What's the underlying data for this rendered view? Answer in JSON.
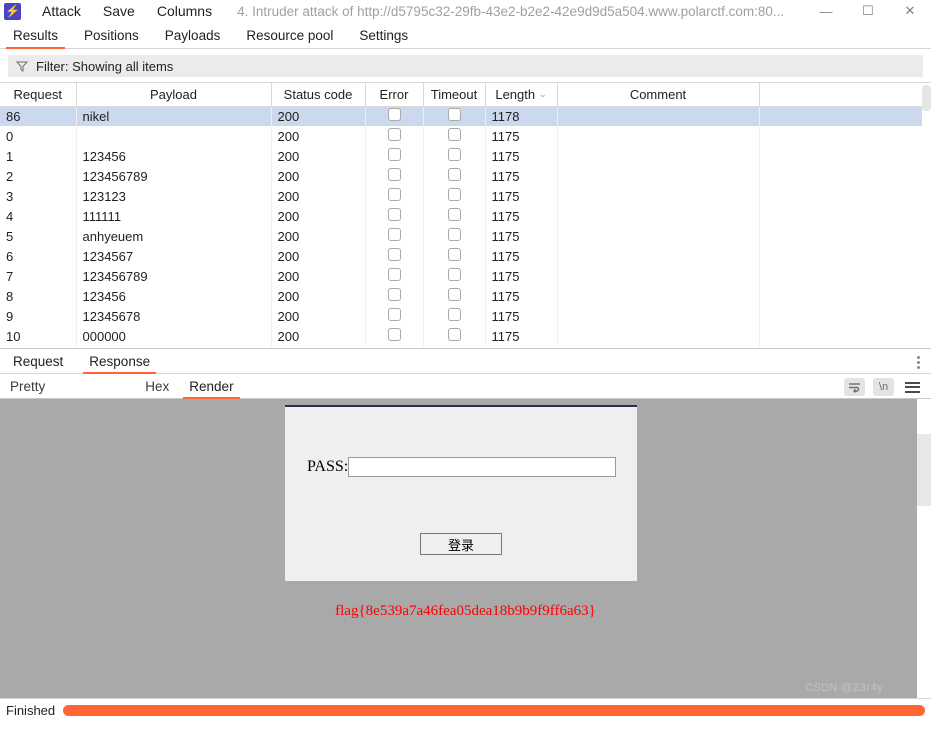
{
  "window": {
    "app_icon": "burp-lightning-icon",
    "title": "4. Intruder attack of http://d5795c32-29fb-43e2-b2e2-42e9d9d5a504.www.polarctf.com:80...",
    "menu": [
      "Attack",
      "Save",
      "Columns"
    ],
    "controls": {
      "minimize": "—",
      "maximize": "☐",
      "close": "✕"
    }
  },
  "tabs": [
    {
      "label": "Results",
      "active": true
    },
    {
      "label": "Positions",
      "active": false
    },
    {
      "label": "Payloads",
      "active": false
    },
    {
      "label": "Resource pool",
      "active": false
    },
    {
      "label": "Settings",
      "active": false
    }
  ],
  "filter": {
    "icon": "funnel-icon",
    "text": "Filter: Showing all items"
  },
  "results_table": {
    "columns": [
      "Request",
      "Payload",
      "Status code",
      "Error",
      "Timeout",
      "Length",
      "Comment",
      ""
    ],
    "sorted_column": "Length",
    "sort_indicator": "⌄",
    "rows": [
      {
        "request": "86",
        "payload": "nikel",
        "status": "200",
        "length": "1178",
        "selected": true
      },
      {
        "request": "0",
        "payload": "",
        "status": "200",
        "length": "1175",
        "selected": false
      },
      {
        "request": "1",
        "payload": "123456",
        "status": "200",
        "length": "1175",
        "selected": false
      },
      {
        "request": "2",
        "payload": "123456789",
        "status": "200",
        "length": "1175",
        "selected": false
      },
      {
        "request": "3",
        "payload": "123123",
        "status": "200",
        "length": "1175",
        "selected": false
      },
      {
        "request": "4",
        "payload": "111111",
        "status": "200",
        "length": "1175",
        "selected": false
      },
      {
        "request": "5",
        "payload": "anhyeuem",
        "status": "200",
        "length": "1175",
        "selected": false
      },
      {
        "request": "6",
        "payload": "1234567",
        "status": "200",
        "length": "1175",
        "selected": false
      },
      {
        "request": "7",
        "payload": "123456789",
        "status": "200",
        "length": "1175",
        "selected": false
      },
      {
        "request": "8",
        "payload": "123456",
        "status": "200",
        "length": "1175",
        "selected": false
      },
      {
        "request": "9",
        "payload": "12345678",
        "status": "200",
        "length": "1175",
        "selected": false
      },
      {
        "request": "10",
        "payload": "000000",
        "status": "200",
        "length": "1175",
        "selected": false
      }
    ]
  },
  "message_tabs": [
    {
      "label": "Request",
      "active": false
    },
    {
      "label": "Response",
      "active": true
    }
  ],
  "view_tabs": [
    {
      "label": "Pretty",
      "active": false
    },
    {
      "label": "Hex",
      "active": false
    },
    {
      "label": "Render",
      "active": true
    }
  ],
  "view_icons": [
    "word-wrap-icon",
    "newline-icon",
    "menu-icon"
  ],
  "newline_icon_label": "\\n",
  "rendered_page": {
    "pass_label": "PASS:",
    "pass_value": "",
    "pass_placeholder": "",
    "login_button": "登录",
    "flag": "flag{8e539a7a46fea05dea18b9b9f9ff6a63}"
  },
  "watermark": "CSDN @Z3r4y",
  "status": {
    "text": "Finished",
    "progress_percent": 100
  },
  "colors": {
    "accent": "#ff6633",
    "logo": "#4b44c9",
    "selected_row": "#cbd9ee",
    "flag_red": "#ff0000",
    "render_bg": "#a9a9a9"
  }
}
